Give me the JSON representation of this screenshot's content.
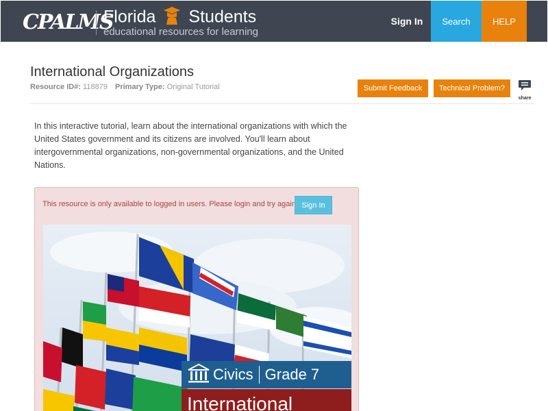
{
  "header": {
    "logo_text": "CPALMS",
    "site_title_left": "Florida",
    "site_title_right": "Students",
    "site_subtitle": "educational resources for learning",
    "nav": {
      "signin": "Sign In",
      "search": "Search",
      "help": "HELP"
    },
    "colors": {
      "bar": "#3f4652",
      "search": "#29a8df",
      "help": "#e8820c"
    }
  },
  "resource": {
    "title": "International Organizations",
    "id_label": "Resource ID#:",
    "id_value": "118879",
    "type_label": "Primary Type:",
    "type_value": "Original Tutorial",
    "buttons": {
      "feedback": "Submit Feedback",
      "technical": "Technical Problem?",
      "share": "share"
    },
    "description": "In this interactive tutorial, learn about the international organizations with which the United States government and its citizens are involved. You'll learn about intergovernmental organizations, non-governmental organizations, and the United Nations."
  },
  "alert": {
    "message": "This resource is only available to logged in users. Please login and try again.",
    "signin": "Sign In"
  },
  "hero": {
    "subject": "Civics",
    "grade": "Grade 7",
    "title_partial": "International"
  }
}
